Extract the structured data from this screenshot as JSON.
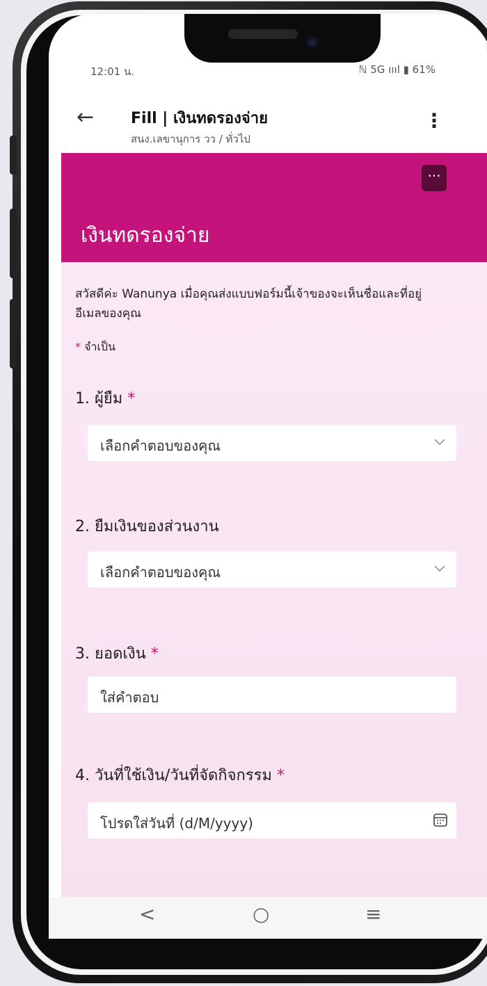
{
  "status_bar": {
    "time": "12:01 น.",
    "right": "ℕ 5G ıııl ▮ 61%"
  },
  "header": {
    "back_icon": "arrow-left-icon",
    "title": "Fill | เงินทดรองจ่าย",
    "subtitle": "สนง.เลขานุการ วว / ทั่วไป",
    "menu_icon": "more-vertical-icon"
  },
  "banner": {
    "color": "#c4137a",
    "more_label": "···",
    "form_title": "เงินทดรองจ่าย"
  },
  "form": {
    "greeting": "สวัสดีค่ะ Wanunya เมื่อคุณส่งแบบฟอร์มนี้เจ้าของจะเห็นชื่อและที่อยู่อีเมลของคุณ",
    "required_note": "จำเป็น",
    "questions": [
      {
        "label": "1. ผู้ยืม",
        "required": "*",
        "placeholder": "เลือกคำตอบของคุณ",
        "type": "dropdown"
      },
      {
        "label": "2. ยืมเงินของส่วนงาน",
        "required": "",
        "placeholder": "เลือกคำตอบของคุณ",
        "type": "dropdown"
      },
      {
        "label": "3. ยอดเงิน",
        "required": "*",
        "placeholder": "ใส่คำตอบ",
        "type": "text"
      },
      {
        "label": "4. วันที่ใช้เงิน/วันที่จัดกิจกรรม",
        "required": "*",
        "placeholder": "โปรดใส่วันที่ (d/M/yyyy)",
        "type": "date"
      }
    ]
  },
  "navbar": {
    "back": "<",
    "home": "○",
    "recents": "≡"
  }
}
